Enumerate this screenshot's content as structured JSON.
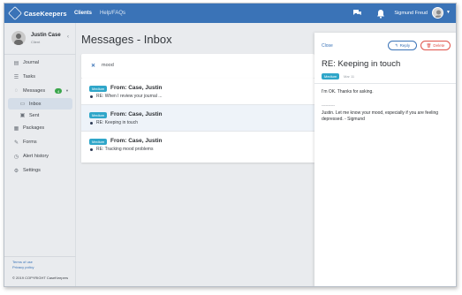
{
  "app": {
    "name": "CaseKeepers"
  },
  "topnav": {
    "items": [
      {
        "label": "Clients"
      },
      {
        "label": "Help/FAQs"
      }
    ]
  },
  "header": {
    "user_name": "Sigmund Freud",
    "icons": [
      "chat-icon",
      "bell-icon"
    ]
  },
  "profile": {
    "name": "Justin Case",
    "role": "Client"
  },
  "sidebar": {
    "items": [
      {
        "label": "Journal",
        "icon": "book-icon"
      },
      {
        "label": "Tasks",
        "icon": "list-icon"
      },
      {
        "label": "Messages",
        "icon": "chat-icon",
        "count": "4"
      },
      {
        "label": "Inbox",
        "icon": "inbox-icon"
      },
      {
        "label": "Sent",
        "icon": "sent-icon"
      },
      {
        "label": "Packages",
        "icon": "package-icon"
      },
      {
        "label": "Forms",
        "icon": "form-icon"
      },
      {
        "label": "Alert history",
        "icon": "clock-icon"
      },
      {
        "label": "Settings",
        "icon": "gear-icon"
      }
    ],
    "footer": {
      "terms": "Terms of use",
      "privacy": "Privacy policy",
      "copyright": "© 2019 COPYRIGHT CaseKeepers"
    }
  },
  "main": {
    "title": "Messages - Inbox",
    "search_term": "mood",
    "messages": [
      {
        "priority": "Medium",
        "from": "From: Case, Justin",
        "subject": "RE: When I review your journal ..."
      },
      {
        "priority": "Medium",
        "from": "From: Case, Justin",
        "subject": "RE: Keeping in touch"
      },
      {
        "priority": "Medium",
        "from": "From: Case, Justin",
        "subject": "RE: Tracking mood problems"
      }
    ]
  },
  "detail": {
    "close_label": "Close",
    "reply_label": "Reply",
    "delete_label": "Delete",
    "title": "RE: Keeping in touch",
    "priority": "Medium",
    "date": "Mar 11",
    "body1": "I'm OK. Thanks for asking.",
    "separator": "----------",
    "body2": "Justin. Let me know your mood, especially if you are feeling depressed. - Sigmund"
  },
  "colors": {
    "brand": "#3a73b7",
    "priority": "#2fa6c9",
    "delete": "#e0534a",
    "badge": "#3aa64b"
  }
}
